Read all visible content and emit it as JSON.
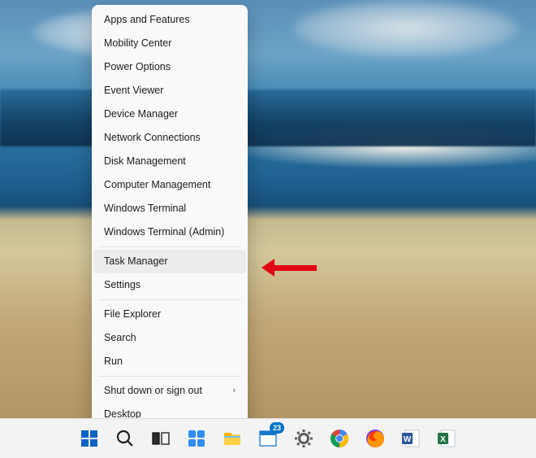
{
  "menu": {
    "groups": [
      [
        "Apps and Features",
        "Mobility Center",
        "Power Options",
        "Event Viewer",
        "Device Manager",
        "Network Connections",
        "Disk Management",
        "Computer Management",
        "Windows Terminal",
        "Windows Terminal (Admin)"
      ],
      [
        "Task Manager",
        "Settings"
      ],
      [
        "File Explorer",
        "Search",
        "Run"
      ],
      [
        "Shut down or sign out",
        "Desktop"
      ]
    ],
    "hovered": "Task Manager",
    "submenu": "Shut down or sign out"
  },
  "taskbar": {
    "items": [
      {
        "id": "start",
        "name": "start-button",
        "icon": "windows"
      },
      {
        "id": "search",
        "name": "search-button",
        "icon": "search"
      },
      {
        "id": "taskview",
        "name": "task-view-button",
        "icon": "taskview"
      },
      {
        "id": "widgets",
        "name": "widgets-button",
        "icon": "widgets"
      },
      {
        "id": "explorer",
        "name": "file-explorer-button",
        "icon": "explorer"
      },
      {
        "id": "calendar",
        "name": "calendar-button",
        "icon": "calendar",
        "badge": "23"
      },
      {
        "id": "settings",
        "name": "settings-button",
        "icon": "gear"
      },
      {
        "id": "chrome",
        "name": "chrome-button",
        "icon": "chrome"
      },
      {
        "id": "firefox",
        "name": "firefox-button",
        "icon": "firefox"
      },
      {
        "id": "word",
        "name": "word-button",
        "icon": "word"
      },
      {
        "id": "excel",
        "name": "excel-button",
        "icon": "excel"
      }
    ]
  }
}
